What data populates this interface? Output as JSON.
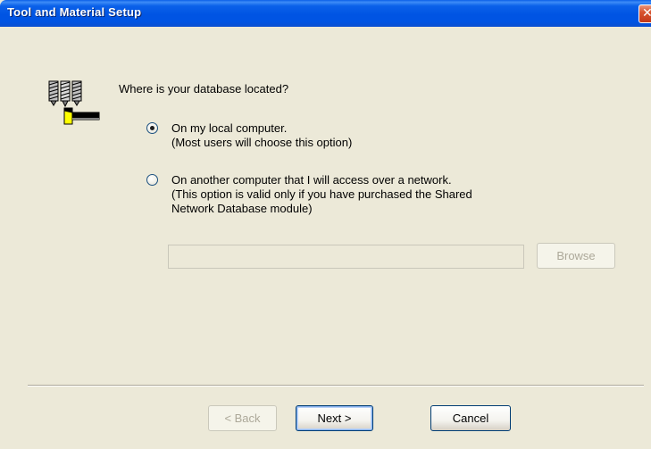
{
  "window": {
    "title": "Tool and Material Setup",
    "close_icon": "close-icon"
  },
  "content": {
    "icon": "database-tools-icon",
    "question": "Where is your database located?",
    "options": [
      {
        "label": "On my local computer.",
        "description": [
          "(Most users will choose this option)"
        ],
        "selected": true
      },
      {
        "label": "On another computer that I will access over a network.",
        "description": [
          "(This option is valid only if you have purchased the Shared",
          "Network Database module)"
        ],
        "selected": false
      }
    ],
    "network_path": {
      "value": "",
      "placeholder": "",
      "enabled": false
    },
    "browse_label": "Browse"
  },
  "footer": {
    "back_label": "< Back",
    "next_label": "Next >",
    "cancel_label": "Cancel"
  },
  "colors": {
    "titlebar": "#0054e3",
    "dialog_background": "#ece9d8",
    "close_button": "#d8532e",
    "disabled_text": "#aca899"
  }
}
